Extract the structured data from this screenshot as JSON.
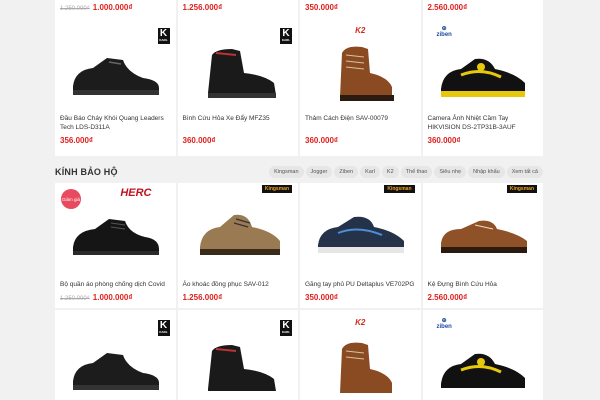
{
  "top_row": [
    {
      "old_price": "1.250.000₫",
      "price": "1.000.000₫"
    },
    {
      "old_price": "",
      "price": "1.256.000₫"
    },
    {
      "old_price": "",
      "price": "350.000₫"
    },
    {
      "old_price": "",
      "price": "2.560.000₫"
    }
  ],
  "row1": [
    {
      "brand": "KARL",
      "brand_icon": "karl-logo",
      "image": "black-work-shoe",
      "name": "Đầu Báo Cháy Khói Quang Leaders Tech LDS-D311A",
      "old_price": "",
      "price": "356.000₫"
    },
    {
      "brand": "KARL",
      "brand_icon": "karl-logo",
      "image": "black-work-boot",
      "name": "Bình Cứu Hỏa Xe Đẩy MFZ35",
      "old_price": "",
      "price": "360.000₫"
    },
    {
      "brand": "K2",
      "brand_icon": "k2-logo",
      "image": "brown-high-boot",
      "name": "Thảm Cách Điện SAV-00079",
      "old_price": "",
      "price": "360.000₫"
    },
    {
      "brand": "ziben",
      "brand_icon": "ziben-logo",
      "image": "black-yellow-sport-shoe",
      "name": "Camera Ảnh Nhiệt Cầm Tay HIKVISION DS-2TP31B-3AUF",
      "old_price": "",
      "price": "360.000₫"
    }
  ],
  "section": {
    "title": "KÍNH BẢO HỘ",
    "filters": [
      "Kingsman",
      "Jogger",
      "Ziben",
      "Karl",
      "K2",
      "Thể thao",
      "Siêu nhẹ",
      "Nhập khẩu",
      "Xem tất cả"
    ]
  },
  "row2": [
    {
      "brand": "HERC",
      "brand_icon": "herc-logo",
      "badge": "Giảm giá",
      "image": "black-leather-shoe",
      "name": "Bộ quần áo phòng chống dịch Covid",
      "old_price": "1.250.000₫",
      "price": "1.000.000₫"
    },
    {
      "brand": "Kingsman",
      "brand_icon": "kingsman-logo",
      "badge": "",
      "image": "tan-hiking-shoe",
      "name": "Áo khoác đồng phục SAV-012",
      "old_price": "",
      "price": "1.256.000₫"
    },
    {
      "brand": "Kingsman",
      "brand_icon": "kingsman-logo",
      "badge": "",
      "image": "navy-sport-shoe",
      "name": "Găng tay phủ PU Deltaplus VE702PG",
      "old_price": "",
      "price": "350.000₫"
    },
    {
      "brand": "Kingsman",
      "brand_icon": "kingsman-logo",
      "badge": "",
      "image": "brown-casual-shoe",
      "name": "Kệ Đựng Bình Cứu Hỏa",
      "old_price": "",
      "price": "2.560.000₫"
    }
  ],
  "row3": [
    {
      "brand": "KARL",
      "brand_icon": "karl-logo",
      "image": "black-work-shoe"
    },
    {
      "brand": "KARL",
      "brand_icon": "karl-logo",
      "image": "black-work-boot"
    },
    {
      "brand": "K2",
      "brand_icon": "k2-logo",
      "image": "brown-high-boot"
    },
    {
      "brand": "ziben",
      "brand_icon": "ziben-logo",
      "image": "black-yellow-sport-shoe"
    }
  ],
  "colors": {
    "price": "#e0201c",
    "old_price": "#aaaaaa",
    "badge": "#e84a5f",
    "chip_bg": "#e6e6e6"
  }
}
